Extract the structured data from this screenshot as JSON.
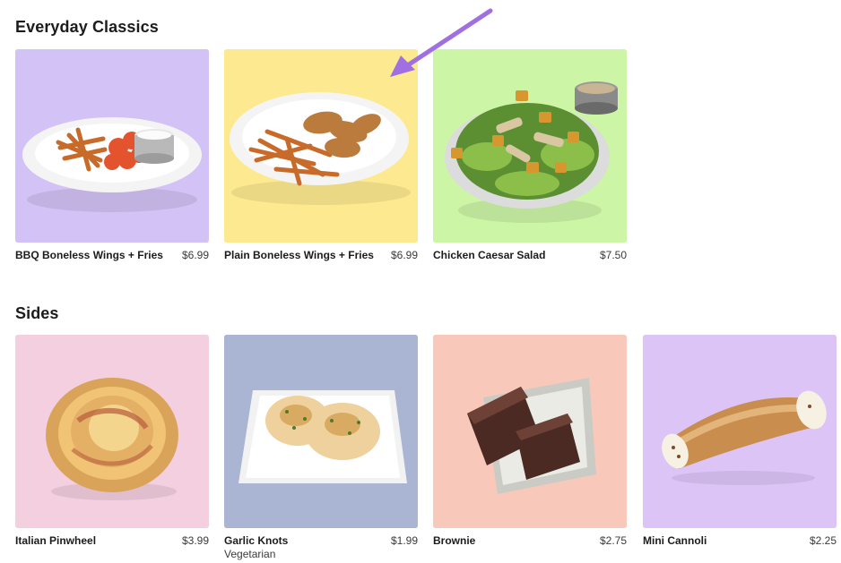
{
  "sections": [
    {
      "title": "Everyday Classics",
      "items": [
        {
          "name": "BBQ Boneless Wings + Fries",
          "price": "$6.99",
          "bg": "#d3c2f5"
        },
        {
          "name": "Plain Boneless Wings + Fries",
          "price": "$6.99",
          "bg": "#fde98f"
        },
        {
          "name": "Chicken Caesar Salad",
          "price": "$7.50",
          "bg": "#cdf5a6"
        }
      ]
    },
    {
      "title": "Sides",
      "items": [
        {
          "name": "Italian Pinwheel",
          "price": "$3.99",
          "bg": "#f3cfe0"
        },
        {
          "name": "Garlic Knots",
          "price": "$1.99",
          "subtitle": "Vegetarian",
          "bg": "#a9b5d2"
        },
        {
          "name": "Brownie",
          "price": "$2.75",
          "bg": "#f8c9bb"
        },
        {
          "name": "Mini Cannoli",
          "price": "$2.25",
          "bg": "#dcc4f7"
        }
      ]
    }
  ],
  "annotation_color": "#a070e0"
}
